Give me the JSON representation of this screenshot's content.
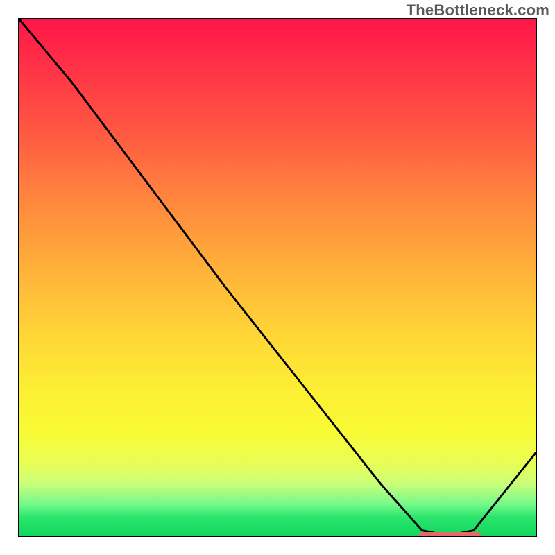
{
  "watermark": "TheBottleneck.com",
  "chart_data": {
    "type": "line",
    "title": "",
    "xlabel": "",
    "ylabel": "",
    "xlim": [
      0,
      100
    ],
    "ylim": [
      0,
      100
    ],
    "series": [
      {
        "name": "bottleneck-curve",
        "x": [
          0,
          10,
          22,
          40,
          55,
          70,
          78,
          83,
          88,
          100
        ],
        "y": [
          100,
          88,
          72,
          48,
          29,
          10,
          1,
          0,
          1,
          16
        ]
      }
    ],
    "annotations": [
      {
        "name": "optimal-range-marker",
        "type": "bar",
        "x_start": 77,
        "x_end": 89,
        "y": 0.5,
        "color": "#e46a67"
      }
    ],
    "background_gradient": {
      "stops": [
        {
          "pos": 0.0,
          "color": "#ff1648"
        },
        {
          "pos": 0.5,
          "color": "#ffb63a"
        },
        {
          "pos": 0.8,
          "color": "#f8fb34"
        },
        {
          "pos": 1.0,
          "color": "#14d75f"
        }
      ]
    }
  }
}
